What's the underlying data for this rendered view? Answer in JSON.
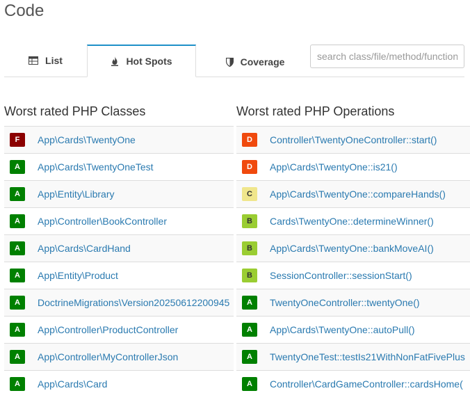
{
  "title": "Code",
  "tabs": [
    {
      "label": "List",
      "icon": "table-icon"
    },
    {
      "label": "Hot Spots",
      "icon": "fire-icon"
    },
    {
      "label": "Coverage",
      "icon": "shield-icon"
    }
  ],
  "search": {
    "placeholder": "search class/file/method/function"
  },
  "classes": {
    "heading": "Worst rated PHP Classes",
    "rows": [
      {
        "grade": "F",
        "name": "App\\Cards\\TwentyOne"
      },
      {
        "grade": "A",
        "name": "App\\Cards\\TwentyOneTest"
      },
      {
        "grade": "A",
        "name": "App\\Entity\\Library"
      },
      {
        "grade": "A",
        "name": "App\\Controller\\BookController"
      },
      {
        "grade": "A",
        "name": "App\\Cards\\CardHand"
      },
      {
        "grade": "A",
        "name": "App\\Entity\\Product"
      },
      {
        "grade": "A",
        "name": "DoctrineMigrations\\Version20250612200945"
      },
      {
        "grade": "A",
        "name": "App\\Controller\\ProductController"
      },
      {
        "grade": "A",
        "name": "App\\Controller\\MyControllerJson"
      },
      {
        "grade": "A",
        "name": "App\\Cards\\Card"
      }
    ]
  },
  "operations": {
    "heading": "Worst rated PHP Operations",
    "rows": [
      {
        "grade": "D",
        "name": "Controller\\TwentyOneController::start()"
      },
      {
        "grade": "D",
        "name": "App\\Cards\\TwentyOne::is21()"
      },
      {
        "grade": "C",
        "name": "App\\Cards\\TwentyOne::compareHands()"
      },
      {
        "grade": "B",
        "name": "Cards\\TwentyOne::determineWinner()"
      },
      {
        "grade": "B",
        "name": "App\\Cards\\TwentyOne::bankMoveAI()"
      },
      {
        "grade": "B",
        "name": "SessionController::sessionStart()"
      },
      {
        "grade": "A",
        "name": "TwentyOneController::twentyOne()"
      },
      {
        "grade": "A",
        "name": "App\\Cards\\TwentyOne::autoPull()"
      },
      {
        "grade": "A",
        "name": "TwentyOneTest::testIs21WithNonFatFivePlus"
      },
      {
        "grade": "A",
        "name": "Controller\\CardGameController::cardsHome("
      }
    ]
  },
  "grade_colors": {
    "F": {
      "bg": "#8b0000",
      "fg": "#ffffff"
    },
    "D": {
      "bg": "#f04a0e",
      "fg": "#ffffff"
    },
    "C": {
      "bg": "#f0e68c",
      "fg": "#333333"
    },
    "B": {
      "bg": "#9acd32",
      "fg": "#333333"
    },
    "A": {
      "bg": "#008000",
      "fg": "#ffffff"
    }
  }
}
